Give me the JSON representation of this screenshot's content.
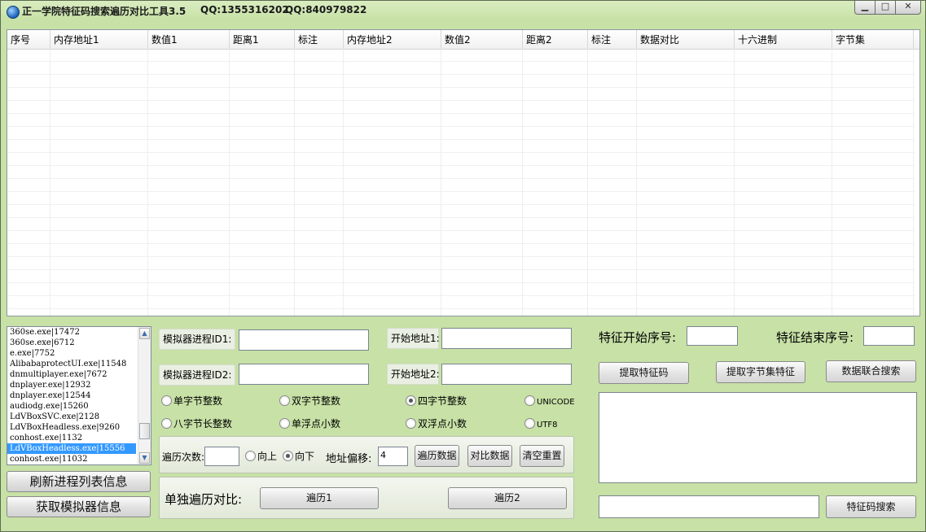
{
  "window": {
    "title": "正一学院特征码搜索遍历对比工具3.5",
    "qq1": "QQ:1355316202",
    "qq2": "QQ:840979822",
    "minimize_glyph": "▁",
    "maximize_glyph": "□",
    "close_glyph": "✕"
  },
  "table": {
    "columns": [
      "序号",
      "内存地址1",
      "数值1",
      "距离1",
      "标注",
      "内存地址2",
      "数值2",
      "距离2",
      "标注",
      "数据对比",
      "十六进制",
      "字节集"
    ]
  },
  "process_list": {
    "items": [
      "360se.exe|17472",
      "360se.exe|6712",
      "e.exe|7752",
      "AlibabaprotectUI.exe|11548",
      "dnmultiplayer.exe|7672",
      "dnplayer.exe|12932",
      "dnplayer.exe|12544",
      "audiodg.exe|15260",
      "LdVBoxSVC.exe|2128",
      "LdVBoxHeadless.exe|9260",
      "conhost.exe|1132",
      "LdVBoxHeadless.exe|15556",
      "conhost.exe|11032"
    ],
    "selected_index": 11,
    "scroll_up_glyph": "▲",
    "scroll_down_glyph": "▼"
  },
  "left_buttons": {
    "refresh": "刷新进程列表信息",
    "get_emulator": "获取模拟器信息"
  },
  "emulator": {
    "pid1_label": "模拟器进程ID1:",
    "pid2_label": "模拟器进程ID2:",
    "start1_label": "开始地址1:",
    "start2_label": "开始地址2:",
    "pid1_value": "",
    "pid2_value": "",
    "start1_value": "",
    "start2_value": ""
  },
  "types": {
    "byte": "单字节整数",
    "short": "双字节整数",
    "int": "四字节整数",
    "unicode": "UNICODE",
    "long": "八字节长整数",
    "float": "单浮点小数",
    "double": "双浮点小数",
    "utf8": "UTF8",
    "selected": "int"
  },
  "traverse": {
    "count_label": "遍历次数:",
    "count_value": "",
    "up_label": "向上",
    "down_label": "向下",
    "direction": "down",
    "offset_label": "地址偏移:",
    "offset_value": "4",
    "traverse_btn": "遍历数据",
    "compare_btn": "对比数据",
    "reset_btn": "清空重置"
  },
  "single": {
    "label": "单独遍历对比:",
    "btn1": "遍历1",
    "btn2": "遍历2"
  },
  "feature": {
    "start_label": "特征开始序号:",
    "end_label": "特征结束序号:",
    "start_value": "",
    "end_value": "",
    "extract_btn": "提取特征码",
    "extract_bytes_btn": "提取字节集特征",
    "joint_search_btn": "数据联合搜索",
    "search_value": "",
    "search_btn": "特征码搜索"
  }
}
